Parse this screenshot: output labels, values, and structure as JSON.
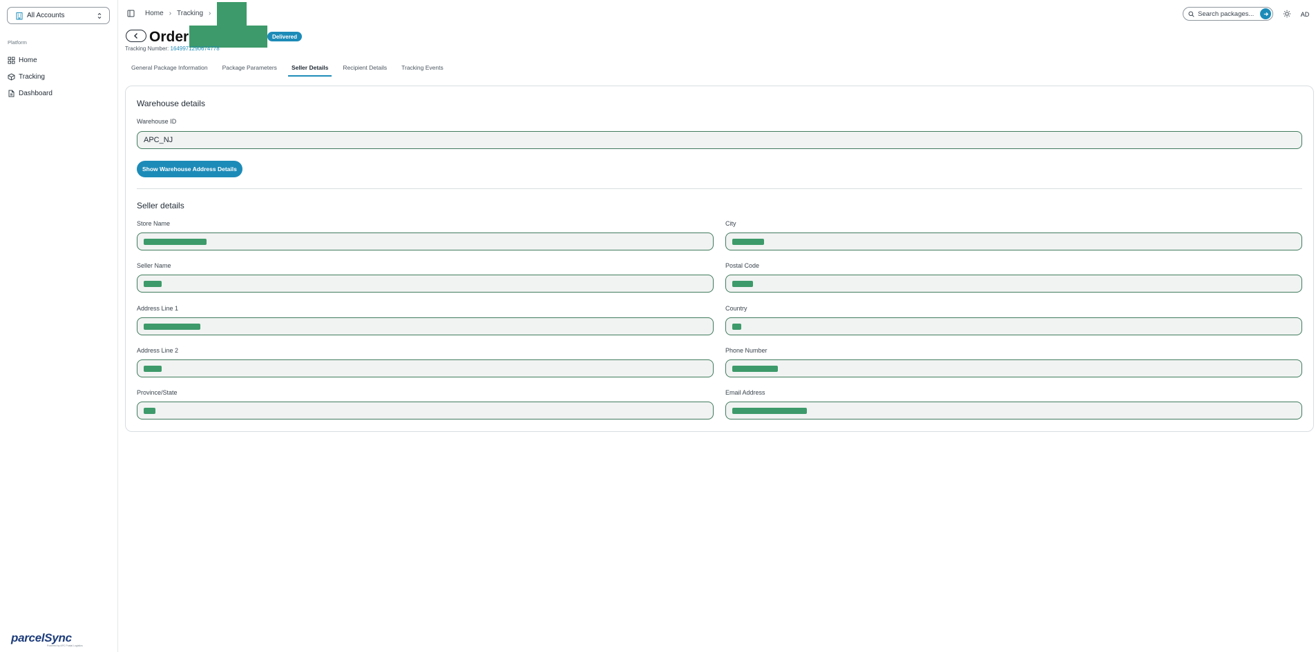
{
  "sidebar": {
    "account_select": "All Accounts",
    "section_label": "Platform",
    "items": [
      {
        "label": "Home",
        "icon": "grid-icon"
      },
      {
        "label": "Tracking",
        "icon": "package-icon"
      },
      {
        "label": "Dashboard",
        "icon": "document-icon"
      }
    ],
    "logo": {
      "word_a": "parcel",
      "word_b": "Sync",
      "tagline": "Powered by APC Postal Logistics"
    }
  },
  "header": {
    "breadcrumb": [
      "Home",
      "Tracking"
    ],
    "search_placeholder": "Search packages...",
    "avatar_initials": "AD"
  },
  "order": {
    "title": "Order",
    "status": "Delivered",
    "tracking_label": "Tracking Number:",
    "tracking_number": "1649971290674778"
  },
  "tabs": [
    {
      "label": "General Package Information",
      "active": false
    },
    {
      "label": "Package Parameters",
      "active": false
    },
    {
      "label": "Seller Details",
      "active": true
    },
    {
      "label": "Recipient Details",
      "active": false
    },
    {
      "label": "Tracking Events",
      "active": false
    }
  ],
  "warehouse": {
    "title": "Warehouse details",
    "id_label": "Warehouse ID",
    "id_value": "APC_NJ",
    "button": "Show Warehouse Address Details"
  },
  "seller": {
    "title": "Seller details",
    "left_fields": [
      {
        "label": "Store Name"
      },
      {
        "label": "Seller Name"
      },
      {
        "label": "Address Line 1"
      },
      {
        "label": "Address Line 2"
      },
      {
        "label": "Province/State"
      }
    ],
    "right_fields": [
      {
        "label": "City"
      },
      {
        "label": "Postal Code"
      },
      {
        "label": "Country"
      },
      {
        "label": "Phone Number"
      },
      {
        "label": "Email Address"
      }
    ]
  },
  "colors": {
    "accent": "#1d8bb8",
    "field_border": "#3f7a5c",
    "redaction": "#3d9a6a"
  }
}
